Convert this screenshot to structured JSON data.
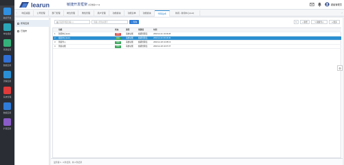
{
  "nav": [
    {
      "label": "敏捷开发",
      "color": "#2f8fe0"
    },
    {
      "label": "单位组织",
      "color": "#2aa7b8"
    },
    {
      "label": "基础设置",
      "color": "#34b27a"
    },
    {
      "label": "数据应用",
      "color": "#2f6fd6"
    },
    {
      "label": "流程应用",
      "color": "#2a8fd4"
    },
    {
      "label": "系统管理",
      "color": "#e03a3a"
    },
    {
      "label": "数据应用",
      "color": "#2f7bd8"
    },
    {
      "label": "扩展应用",
      "color": "#8a5cc7"
    }
  ],
  "header": {
    "title": "敏捷开发框架",
    "version": "[标准版V7.0]",
    "user": "超级管理员"
  },
  "tabs": [
    "响应桌面",
    "公司管理",
    "部门管理",
    "岗位管理",
    "角色管理",
    "用户管理",
    "功能模块",
    "功能表单",
    "功能模块",
    "代码生成",
    "新闻...新闻中心(test)"
  ],
  "tabs_active_index": 9,
  "tree": [
    {
      "label": "所有应用"
    },
    {
      "label": "已发布"
    }
  ],
  "toolbar": {
    "input1_placeholder": "请选择/报表(输入)",
    "input2_placeholder": "请输入查询关键字",
    "search_label": "查询",
    "refresh_icon": "refresh-icon",
    "add_label": "新增",
    "import_label": "模板导入",
    "more_label": "更多"
  },
  "grid": {
    "columns": [
      "",
      "功能",
      "状态",
      "类型",
      "创建者",
      "时间"
    ],
    "rows": [
      {
        "num": "1",
        "name": "新闻中心(test)",
        "status": "禁用",
        "status_color": "#d9534f",
        "type": "系统功能",
        "creator": "超级管理员",
        "time": "2018-12-21 10:29:28",
        "selected": false
      },
      {
        "num": "2",
        "name": "报表中心(test)",
        "status": "禁用",
        "status_color": "#3aa65a",
        "type": "系统功能",
        "creator": "超级管理员",
        "time": "2018-12-21 09:46:00",
        "selected": true
      },
      {
        "num": "3",
        "name": "测试导入",
        "status": "禁用",
        "status_color": "#3aa65a",
        "type": "系统功能",
        "creator": "超级管理员",
        "time": "2018-12-18 14:08:13",
        "selected": false
      },
      {
        "num": "4",
        "name": "测试功能",
        "status": "禁用",
        "status_color": "#3aa65a",
        "type": "系统功能",
        "creator": "超级管理员",
        "time": "2018-12-18 10:37:37",
        "selected": false
      }
    ]
  },
  "pager": {
    "text": "显示第 1 - 4 条记录，共 4 条记录"
  },
  "colors": {
    "brand": "#2f4a8a",
    "accent": "#2b8fd1"
  }
}
